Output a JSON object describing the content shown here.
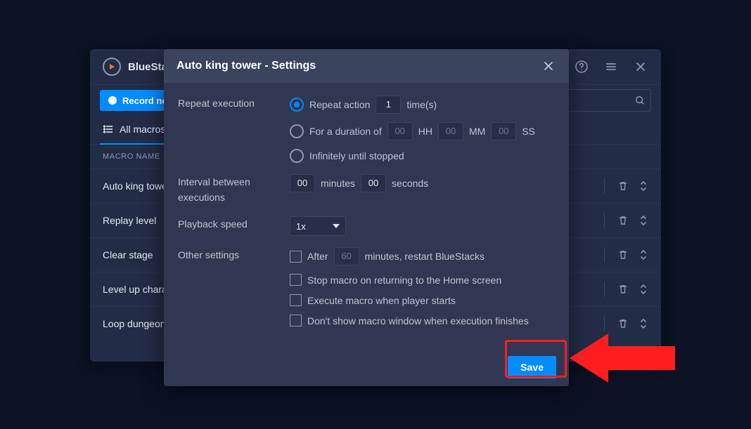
{
  "app": {
    "title": "BlueStacks"
  },
  "toolbar": {
    "record_label": "Record new"
  },
  "tabs": {
    "all_label": "All macros"
  },
  "list": {
    "header": "MACRO NAME",
    "rows": [
      "Auto king tower",
      "Replay level",
      "Clear stage",
      "Level up character",
      "Loop dungeon"
    ]
  },
  "modal": {
    "title": "Auto king tower - Settings",
    "sections": {
      "repeat": {
        "label": "Repeat execution",
        "opt_action_pre": "Repeat action",
        "opt_action_val": "1",
        "opt_action_post": "time(s)",
        "opt_duration_pre": "For a duration of",
        "opt_duration_hh": "00",
        "opt_duration_hhlbl": "HH",
        "opt_duration_mm": "00",
        "opt_duration_mmlbl": "MM",
        "opt_duration_ss": "00",
        "opt_duration_sslbl": "SS",
        "opt_infinite": "Infinitely until stopped"
      },
      "interval": {
        "label": "Interval between executions",
        "minutes_val": "00",
        "minutes_lbl": "minutes",
        "seconds_val": "00",
        "seconds_lbl": "seconds"
      },
      "speed": {
        "label": "Playback speed",
        "value": "1x"
      },
      "other": {
        "label": "Other settings",
        "after_pre": "After",
        "after_val": "60",
        "after_post": "minutes, restart BlueStacks",
        "stop_home": "Stop macro on returning to the Home screen",
        "exec_player": "Execute macro when player starts",
        "no_window": "Don't show macro window when execution finishes"
      }
    },
    "save": "Save"
  }
}
